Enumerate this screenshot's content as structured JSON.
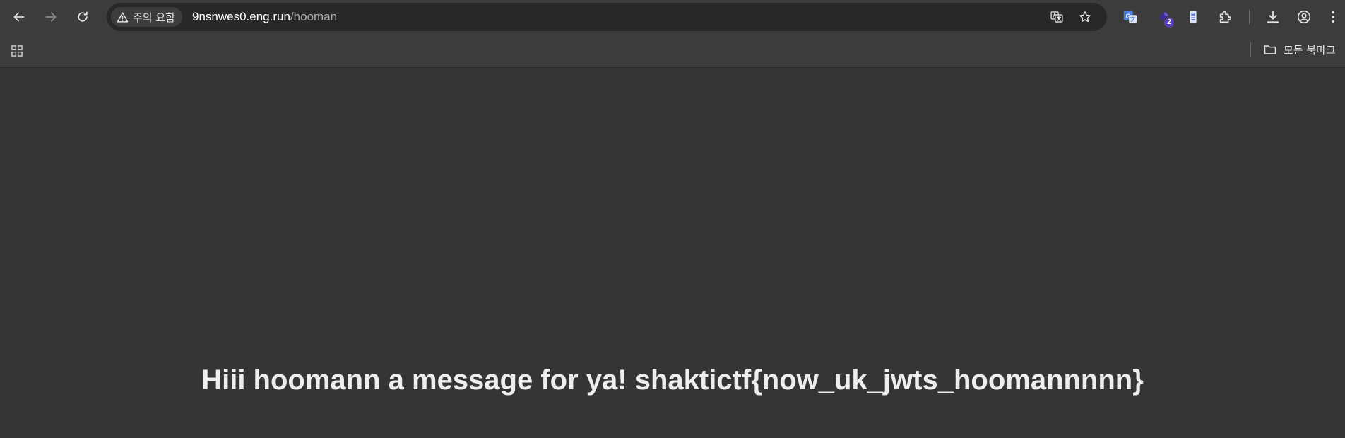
{
  "toolbar": {
    "security_chip_label": "주의 요함",
    "url_host": "9nsnwes0.eng.run",
    "url_path": "/hooman",
    "extensions": [
      {
        "icon": "google-translate-extension-icon"
      },
      {
        "icon": "extension-badge-icon",
        "badge": "2"
      },
      {
        "icon": "bookmark-extension-icon"
      }
    ]
  },
  "bookmarks_bar": {
    "all_bookmarks_label": "모든 북마크"
  },
  "page": {
    "message": "Hiii hoomann a message for ya! shaktictf{now_uk_jwts_hoomannnnn}"
  },
  "colors": {
    "toolbar_bg": "#3c3c3c",
    "omnibox_bg": "#282828",
    "page_bg": "#353535",
    "text": "#eeeeee",
    "badge": "#5b3fb5"
  }
}
